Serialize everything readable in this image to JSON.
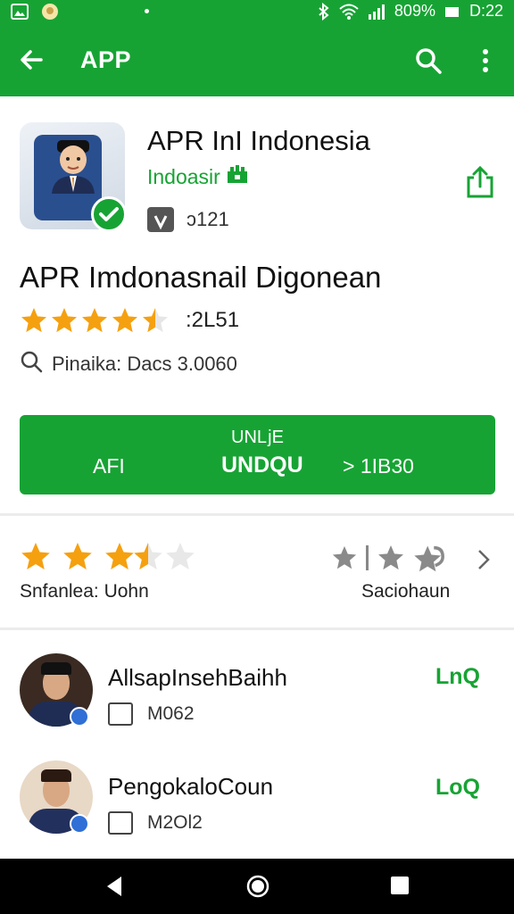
{
  "status_bar": {
    "battery": "809%",
    "time": "D:22"
  },
  "app_bar": {
    "title": "APP"
  },
  "app": {
    "title": "APR InI Indonesia",
    "developer": "Indoasir",
    "age_rating": "ɔ121",
    "subtitle": "APR Imdonasnail Digonean",
    "rating_count": ":2L51",
    "info": "Pinaika: Dacs 3.0060"
  },
  "install": {
    "top_label": "UNǈE",
    "left_label": "AFI",
    "main_label": "UNDQU",
    "right_label": "> 1IB30"
  },
  "ratings": {
    "left_label": "Snfanlea: Uohn",
    "right_label": "Saciohaun"
  },
  "list": [
    {
      "title": "AllsapInsehBaihh",
      "meta": "M062",
      "action": "LnQ"
    },
    {
      "title": "PengokaloCoun",
      "meta": "M2Ol2",
      "action": "LoQ"
    }
  ],
  "colors": {
    "brand_green": "#17a334",
    "star": "#f5a00f"
  }
}
